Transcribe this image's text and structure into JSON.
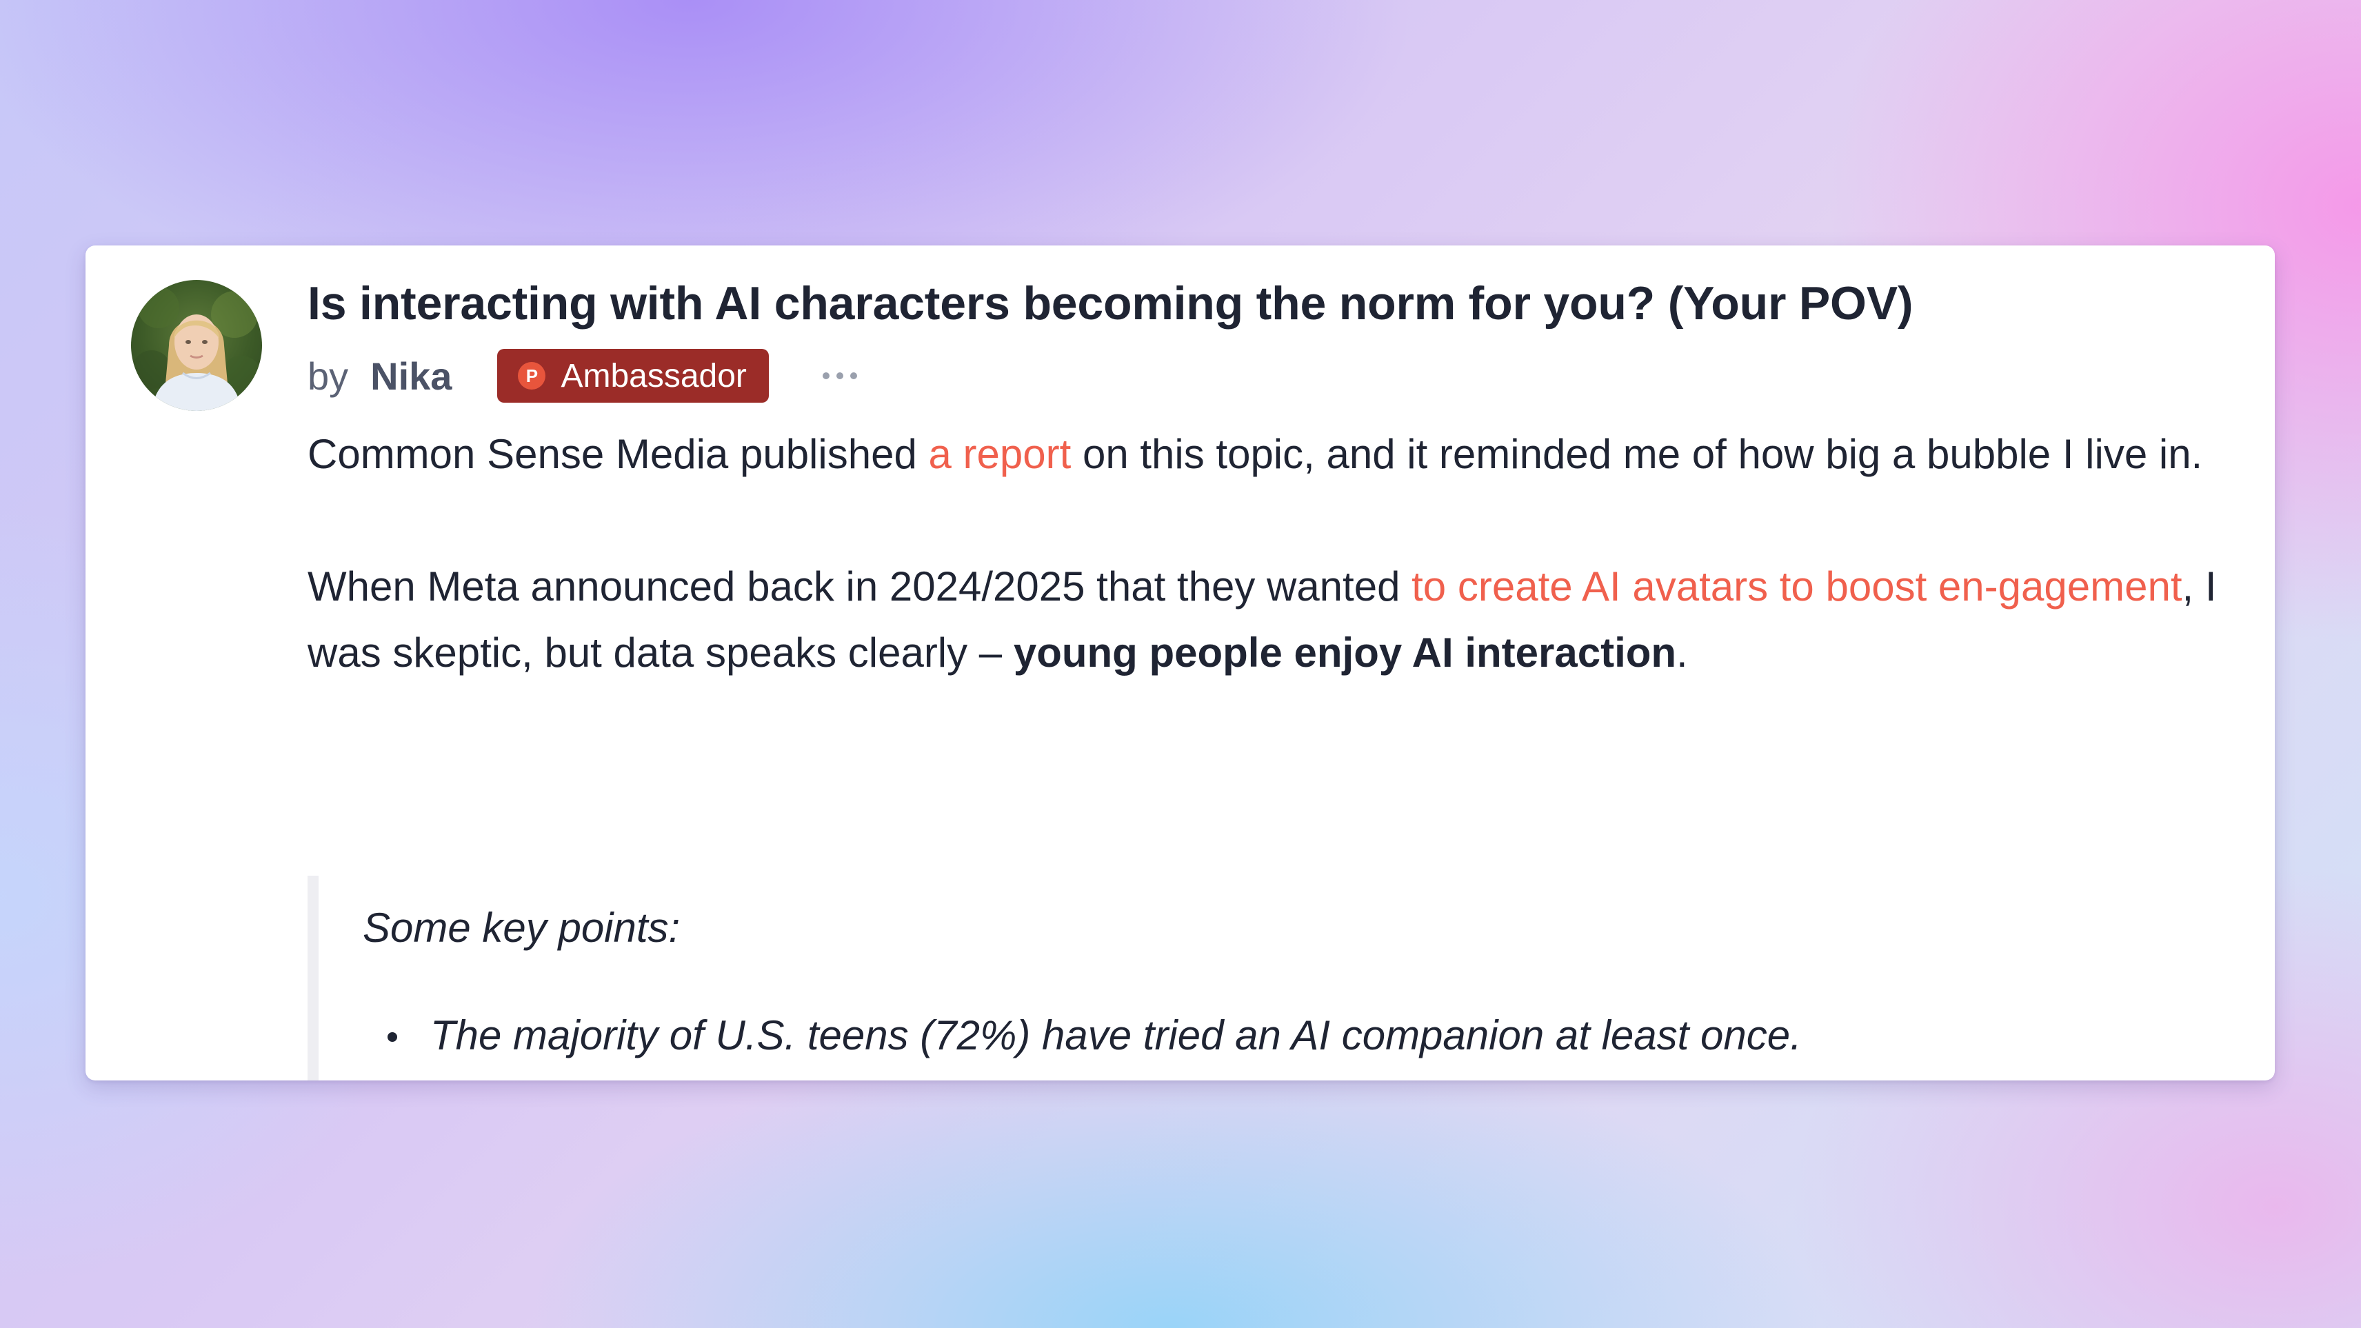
{
  "post": {
    "title": "Is interacting with AI characters becoming the norm for you? (Your POV)",
    "by_label": "by",
    "author": "Nika",
    "badge": {
      "icon_letter": "P",
      "label": "Ambassador"
    },
    "paragraph1": {
      "before": "Common Sense Media published ",
      "link": "a report",
      "after": " on this topic, and it reminded me of how big a bubble I live in."
    },
    "paragraph2": {
      "before": "When Meta announced back in 2024/2025 that they wanted ",
      "link": "to create AI avatars to boost en-gagement",
      "middle": ", I was skeptic, but data speaks clearly – ",
      "bold": "young people enjoy AI interaction",
      "after": "."
    },
    "blockquote": {
      "title": "Some key points:",
      "items": [
        "The majority of U.S. teens (72%) have tried an AI companion at least once."
      ]
    }
  },
  "colors": {
    "link": "#f0604d",
    "badge_bg": "#9b2c28",
    "badge_icon": "#e8553c",
    "text": "#1f2433"
  },
  "icons": {
    "avatar": "user-avatar-photo",
    "more": "more-horizontal-icon",
    "badge": "product-hunt-icon"
  }
}
